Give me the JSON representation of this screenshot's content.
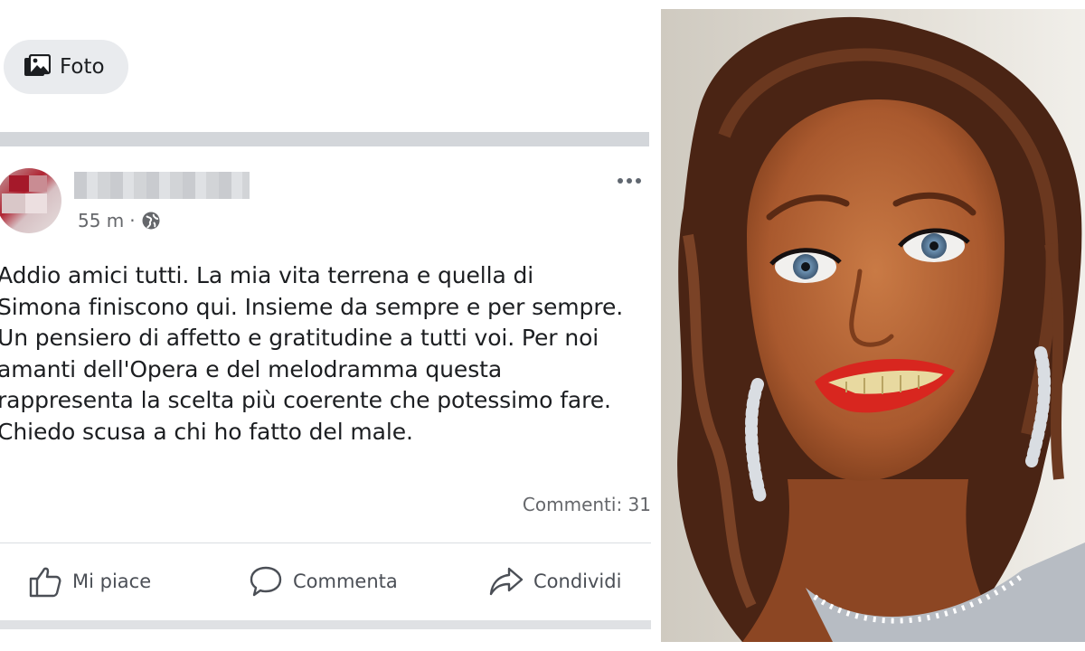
{
  "top_bar": {
    "photo_button_label": "Foto"
  },
  "post": {
    "time": "55 m",
    "separator": "·",
    "body": "Addio amici tutti. La mia vita terrena e quella di\nSimona finiscono qui. Insieme da sempre e per sempre.\nUn pensiero di affetto e gratitudine a tutti voi. Per noi\namanti dell'Opera e del melodramma questa\nrappresenta la scelta più coerente che potessimo fare.\nChiedo scusa a chi ho fatto del male.",
    "comments_label": "Commenti: 31"
  },
  "actions": {
    "like_label": "Mi piace",
    "comment_label": "Commenta",
    "share_label": "Condividi"
  },
  "icons": {
    "photo": "photo-icon",
    "globe": "globe-icon",
    "more": "more-dots-icon",
    "like": "thumbs-up-icon",
    "comment": "speech-bubble-icon",
    "share": "share-arrow-icon"
  },
  "colors": {
    "text_primary": "#1c1e21",
    "text_secondary": "#65676b",
    "chip_background": "#e9ebee",
    "separator": "#d3d6da"
  }
}
